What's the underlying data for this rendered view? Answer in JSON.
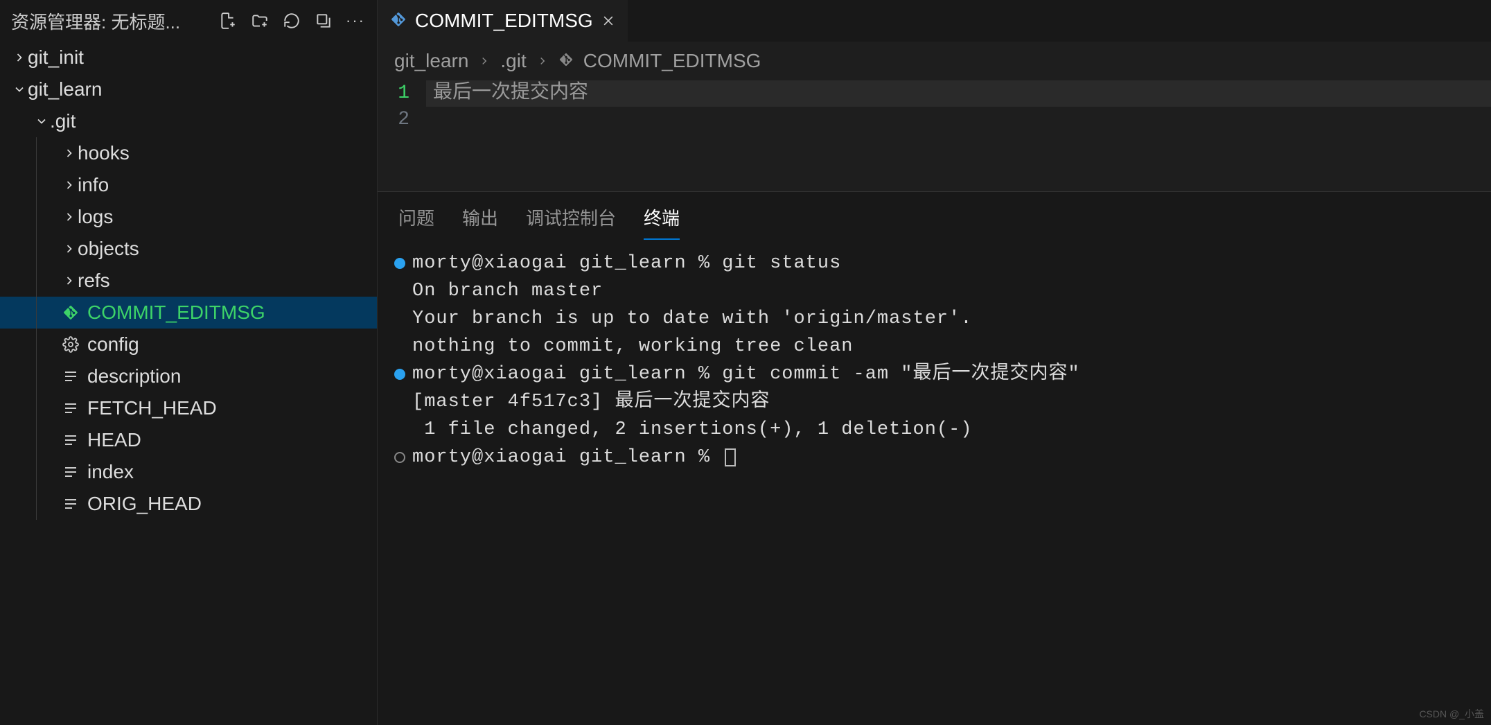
{
  "sidebar": {
    "title": "资源管理器: 无标题...",
    "tree": [
      {
        "type": "folder",
        "label": "git_init",
        "expanded": false,
        "indent": 0
      },
      {
        "type": "folder",
        "label": "git_learn",
        "expanded": true,
        "indent": 0
      },
      {
        "type": "folder",
        "label": ".git",
        "expanded": true,
        "indent": 1
      },
      {
        "type": "folder",
        "label": "hooks",
        "expanded": false,
        "indent": 2
      },
      {
        "type": "folder",
        "label": "info",
        "expanded": false,
        "indent": 2
      },
      {
        "type": "folder",
        "label": "logs",
        "expanded": false,
        "indent": 2
      },
      {
        "type": "folder",
        "label": "objects",
        "expanded": false,
        "indent": 2
      },
      {
        "type": "folder",
        "label": "refs",
        "expanded": false,
        "indent": 2
      },
      {
        "type": "file",
        "label": "COMMIT_EDITMSG",
        "icon": "git",
        "indent": 3,
        "selected": true
      },
      {
        "type": "file",
        "label": "config",
        "icon": "gear",
        "indent": 3
      },
      {
        "type": "file",
        "label": "description",
        "icon": "lines",
        "indent": 3
      },
      {
        "type": "file",
        "label": "FETCH_HEAD",
        "icon": "lines",
        "indent": 3
      },
      {
        "type": "file",
        "label": "HEAD",
        "icon": "lines",
        "indent": 3
      },
      {
        "type": "file",
        "label": "index",
        "icon": "lines",
        "indent": 3
      },
      {
        "type": "file",
        "label": "ORIG_HEAD",
        "icon": "lines",
        "indent": 3
      }
    ]
  },
  "tabs": {
    "active": {
      "label": "COMMIT_EDITMSG"
    }
  },
  "breadcrumb": {
    "seg1": "git_learn",
    "seg2": ".git",
    "seg3": "COMMIT_EDITMSG"
  },
  "editor": {
    "lines": [
      {
        "num": "1",
        "text": "最后一次提交内容",
        "active": true
      },
      {
        "num": "2",
        "text": "",
        "active": false
      }
    ]
  },
  "panel": {
    "tabs": {
      "problems": "问题",
      "output": "输出",
      "debug": "调试控制台",
      "terminal": "终端"
    },
    "active": "terminal"
  },
  "terminal": {
    "lines": [
      {
        "bullet": "blue",
        "text": "morty@xiaogai git_learn % git status"
      },
      {
        "bullet": "",
        "text": "On branch master"
      },
      {
        "bullet": "",
        "text": "Your branch is up to date with 'origin/master'."
      },
      {
        "bullet": "",
        "text": ""
      },
      {
        "bullet": "",
        "text": "nothing to commit, working tree clean"
      },
      {
        "bullet": "blue",
        "text": "morty@xiaogai git_learn % git commit -am \"最后一次提交内容\""
      },
      {
        "bullet": "",
        "text": "[master 4f517c3] 最后一次提交内容"
      },
      {
        "bullet": "",
        "text": " 1 file changed, 2 insertions(+), 1 deletion(-)"
      },
      {
        "bullet": "gray",
        "text": "morty@xiaogai git_learn % ",
        "cursor": true
      }
    ]
  },
  "watermark": "CSDN @_小盖"
}
